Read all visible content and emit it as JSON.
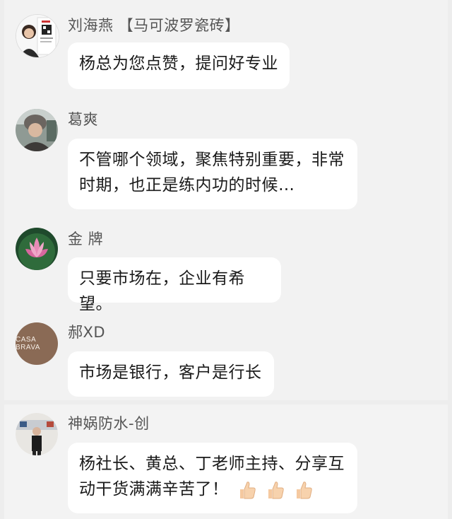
{
  "messages": [
    {
      "sender": "刘海燕 【马可波罗瓷砖】",
      "text": "杨总为您点赞，提问好专业",
      "avatar": "person-with-qr-card"
    },
    {
      "sender": "葛爽",
      "line1": "不管哪个领域，聚焦特别重要，非常",
      "line2": "时期，也正是练内功的时候…",
      "avatar": "person-in-knit-hat"
    },
    {
      "sender": "金 牌",
      "text": "只要市场在，企业有希望。",
      "avatar": "lotus-flower"
    },
    {
      "sender": "郝XD",
      "text": "市场是银行，客户是行长",
      "avatar": "casa-brava-logo",
      "avatar_text": "CASA BRAVA"
    },
    {
      "sender": "神娲防水-创",
      "line1": "杨社长、黄总、丁老师主持、分享互",
      "line2": "动干货满满辛苦了！",
      "avatar": "person-standing-indoors",
      "emoji": [
        "thumbs-up",
        "thumbs-up",
        "thumbs-up"
      ]
    }
  ],
  "colors": {
    "background": "#ededed",
    "bubble": "#ffffff",
    "name": "#555555",
    "text": "#1a1a1a"
  }
}
